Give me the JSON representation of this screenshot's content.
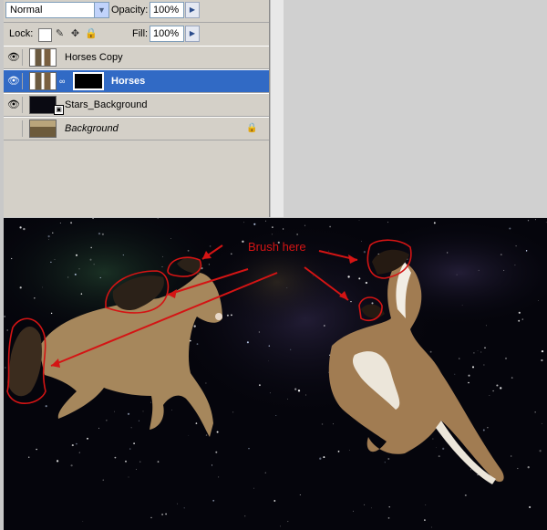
{
  "layers_panel": {
    "blend_mode": "Normal",
    "opacity_label": "Opacity:",
    "opacity_value": "100%",
    "lock_label": "Lock:",
    "fill_label": "Fill:",
    "fill_value": "100%",
    "layers": [
      {
        "name": "Horses Copy",
        "visible": true,
        "selected": false
      },
      {
        "name": "Horses",
        "visible": true,
        "selected": true
      },
      {
        "name": "Stars_Background",
        "visible": true,
        "selected": false
      },
      {
        "name": "Background",
        "visible": false,
        "selected": false,
        "locked": true
      }
    ]
  },
  "canvas": {
    "annotation": "Brush here",
    "annotation_color": "#d41414",
    "background_color": "#05050c"
  },
  "colors": {
    "selection": "#316ac5",
    "panel": "#d4d0c8"
  }
}
